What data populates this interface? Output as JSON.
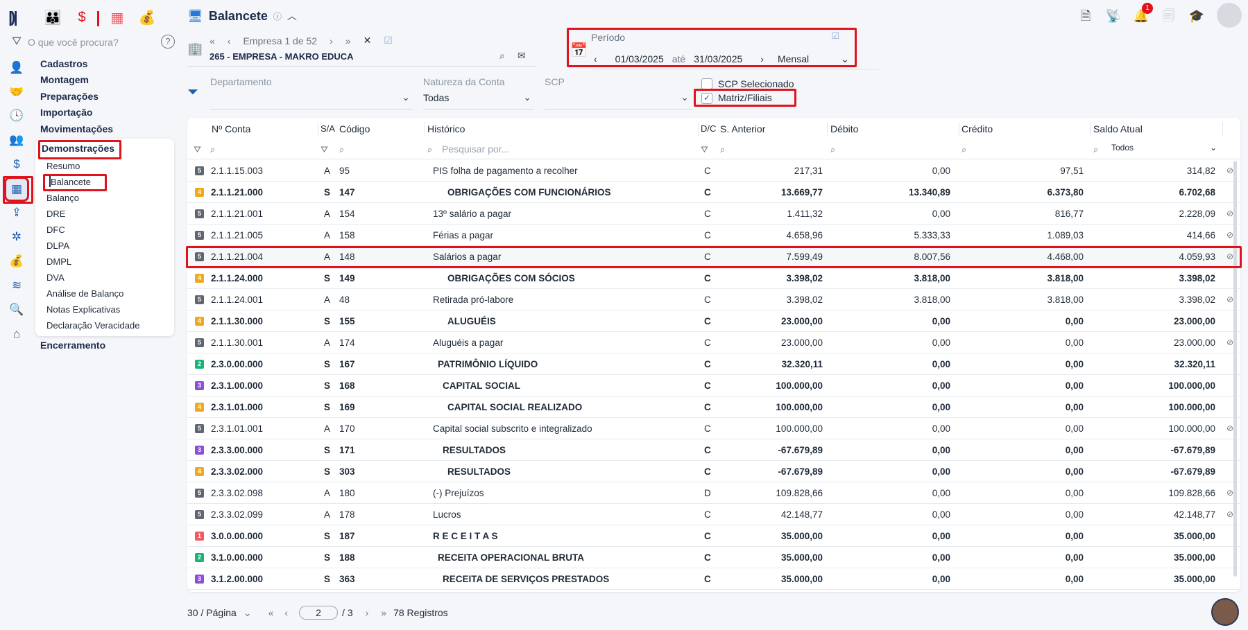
{
  "app": {
    "title": "Balancete",
    "search_placeholder": "O que você procura?",
    "help_icon": "?"
  },
  "menu": {
    "main": [
      "Cadastros",
      "Montagem",
      "Preparações",
      "Importação",
      "Movimentações",
      "Demonstrações"
    ],
    "sub": [
      "Resumo",
      "Balancete",
      "Balanço",
      "DRE",
      "DFC",
      "DLPA",
      "DMPL",
      "DVA",
      "Análise de Balanço",
      "Notas Explicativas",
      "Declaração Veracidade"
    ],
    "after": "Encerramento"
  },
  "company": {
    "nav_label": "Empresa 1 de 52",
    "name": "265 - EMPRESA - MAKRO EDUCA"
  },
  "period": {
    "label": "Período",
    "from": "01/03/2025",
    "sep": "até",
    "to": "31/03/2025",
    "mode": "Mensal"
  },
  "filters": {
    "departamento_label": "Departamento",
    "natureza_label": "Natureza da Conta",
    "natureza_value": "Todas",
    "scp_label": "SCP",
    "scp_selecionado": "SCP Selecionado",
    "matriz_filiais": "Matriz/Filiais"
  },
  "notifications": {
    "count": "1"
  },
  "grid": {
    "headers": {
      "conta": "Nº Conta",
      "sa": "S/A",
      "codigo": "Código",
      "historico": "Histórico",
      "dc": "D/C",
      "anterior": "S. Anterior",
      "debito": "Débito",
      "credito": "Crédito",
      "saldo": "Saldo Atual"
    },
    "search_placeholder": "Pesquisar por...",
    "saldo_filter": "Todos",
    "rows": [
      {
        "lvl": "5",
        "conta": "2.1.1.15.003",
        "sa": "A",
        "cod": "95",
        "hist": "PIS folha de pagamento a recolher",
        "indent": 0,
        "dc": "C",
        "ant": "217,31",
        "deb": "0,00",
        "cred": "97,51",
        "saldo": "314,82",
        "bold": false
      },
      {
        "lvl": "4",
        "conta": "2.1.1.21.000",
        "sa": "S",
        "cod": "147",
        "hist": "OBRIGAÇÕES COM FUNCIONÁRIOS",
        "indent": 3,
        "dc": "C",
        "ant": "13.669,77",
        "deb": "13.340,89",
        "cred": "6.373,80",
        "saldo": "6.702,68",
        "bold": true
      },
      {
        "lvl": "5",
        "conta": "2.1.1.21.001",
        "sa": "A",
        "cod": "154",
        "hist": "13º salário a pagar",
        "indent": 0,
        "dc": "C",
        "ant": "1.411,32",
        "deb": "0,00",
        "cred": "816,77",
        "saldo": "2.228,09",
        "bold": false
      },
      {
        "lvl": "5",
        "conta": "2.1.1.21.005",
        "sa": "A",
        "cod": "158",
        "hist": "Férias a pagar",
        "indent": 0,
        "dc": "C",
        "ant": "4.658,96",
        "deb": "5.333,33",
        "cred": "1.089,03",
        "saldo": "414,66",
        "bold": false
      },
      {
        "lvl": "5",
        "conta": "2.1.1.21.004",
        "sa": "A",
        "cod": "148",
        "hist": "Salários a pagar",
        "indent": 0,
        "dc": "C",
        "ant": "7.599,49",
        "deb": "8.007,56",
        "cred": "4.468,00",
        "saldo": "4.059,93",
        "bold": false,
        "highlight": true
      },
      {
        "lvl": "4",
        "conta": "2.1.1.24.000",
        "sa": "S",
        "cod": "149",
        "hist": "OBRIGAÇÕES COM SÓCIOS",
        "indent": 3,
        "dc": "C",
        "ant": "3.398,02",
        "deb": "3.818,00",
        "cred": "3.818,00",
        "saldo": "3.398,02",
        "bold": true
      },
      {
        "lvl": "5",
        "conta": "2.1.1.24.001",
        "sa": "A",
        "cod": "48",
        "hist": "Retirada pró-labore",
        "indent": 0,
        "dc": "C",
        "ant": "3.398,02",
        "deb": "3.818,00",
        "cred": "3.818,00",
        "saldo": "3.398,02",
        "bold": false
      },
      {
        "lvl": "4",
        "conta": "2.1.1.30.000",
        "sa": "S",
        "cod": "155",
        "hist": "ALUGUÉIS",
        "indent": 3,
        "dc": "C",
        "ant": "23.000,00",
        "deb": "0,00",
        "cred": "0,00",
        "saldo": "23.000,00",
        "bold": true
      },
      {
        "lvl": "5",
        "conta": "2.1.1.30.001",
        "sa": "A",
        "cod": "174",
        "hist": "Aluguéis a pagar",
        "indent": 0,
        "dc": "C",
        "ant": "23.000,00",
        "deb": "0,00",
        "cred": "0,00",
        "saldo": "23.000,00",
        "bold": false
      },
      {
        "lvl": "2",
        "conta": "2.3.0.00.000",
        "sa": "S",
        "cod": "167",
        "hist": "PATRIMÔNIO LÍQUIDO",
        "indent": 1,
        "dc": "C",
        "ant": "32.320,11",
        "deb": "0,00",
        "cred": "0,00",
        "saldo": "32.320,11",
        "bold": true
      },
      {
        "lvl": "3",
        "conta": "2.3.1.00.000",
        "sa": "S",
        "cod": "168",
        "hist": "CAPITAL SOCIAL",
        "indent": 2,
        "dc": "C",
        "ant": "100.000,00",
        "deb": "0,00",
        "cred": "0,00",
        "saldo": "100.000,00",
        "bold": true
      },
      {
        "lvl": "4",
        "conta": "2.3.1.01.000",
        "sa": "S",
        "cod": "169",
        "hist": "CAPITAL SOCIAL REALIZADO",
        "indent": 3,
        "dc": "C",
        "ant": "100.000,00",
        "deb": "0,00",
        "cred": "0,00",
        "saldo": "100.000,00",
        "bold": true
      },
      {
        "lvl": "5",
        "conta": "2.3.1.01.001",
        "sa": "A",
        "cod": "170",
        "hist": "Capital social subscrito e integralizado",
        "indent": 0,
        "dc": "C",
        "ant": "100.000,00",
        "deb": "0,00",
        "cred": "0,00",
        "saldo": "100.000,00",
        "bold": false
      },
      {
        "lvl": "3",
        "conta": "2.3.3.00.000",
        "sa": "S",
        "cod": "171",
        "hist": "RESULTADOS",
        "indent": 2,
        "dc": "C",
        "ant": "-67.679,89",
        "deb": "0,00",
        "cred": "0,00",
        "saldo": "-67.679,89",
        "bold": true
      },
      {
        "lvl": "4",
        "conta": "2.3.3.02.000",
        "sa": "S",
        "cod": "303",
        "hist": "RESULTADOS",
        "indent": 3,
        "dc": "C",
        "ant": "-67.679,89",
        "deb": "0,00",
        "cred": "0,00",
        "saldo": "-67.679,89",
        "bold": true
      },
      {
        "lvl": "5",
        "conta": "2.3.3.02.098",
        "sa": "A",
        "cod": "180",
        "hist": "(-) Prejuízos",
        "indent": 0,
        "dc": "D",
        "ant": "109.828,66",
        "deb": "0,00",
        "cred": "0,00",
        "saldo": "109.828,66",
        "bold": false
      },
      {
        "lvl": "5",
        "conta": "2.3.3.02.099",
        "sa": "A",
        "cod": "178",
        "hist": "Lucros",
        "indent": 0,
        "dc": "C",
        "ant": "42.148,77",
        "deb": "0,00",
        "cred": "0,00",
        "saldo": "42.148,77",
        "bold": false
      },
      {
        "lvl": "1",
        "conta": "3.0.0.00.000",
        "sa": "S",
        "cod": "187",
        "hist": "R E C E I T A S",
        "indent": 0,
        "dc": "C",
        "ant": "35.000,00",
        "deb": "0,00",
        "cred": "0,00",
        "saldo": "35.000,00",
        "bold": true
      },
      {
        "lvl": "2",
        "conta": "3.1.0.00.000",
        "sa": "S",
        "cod": "188",
        "hist": "RECEITA OPERACIONAL BRUTA",
        "indent": 1,
        "dc": "C",
        "ant": "35.000,00",
        "deb": "0,00",
        "cred": "0,00",
        "saldo": "35.000,00",
        "bold": true
      },
      {
        "lvl": "3",
        "conta": "3.1.2.00.000",
        "sa": "S",
        "cod": "363",
        "hist": "RECEITA DE SERVIÇOS PRESTADOS",
        "indent": 2,
        "dc": "C",
        "ant": "35.000,00",
        "deb": "0,00",
        "cred": "0,00",
        "saldo": "35.000,00",
        "bold": true
      }
    ]
  },
  "level_colors": {
    "1": "#ef5a63",
    "2": "#19b37a",
    "3": "#8c4fd8",
    "4": "#f0a81c",
    "5": "#5f6670"
  },
  "footer": {
    "per_page": "30 / Página",
    "page": "2",
    "total_pages": "/ 3",
    "records": "78 Registros"
  },
  "colors": {
    "accent": "#1f5fae",
    "highlight": "#e0121b"
  }
}
